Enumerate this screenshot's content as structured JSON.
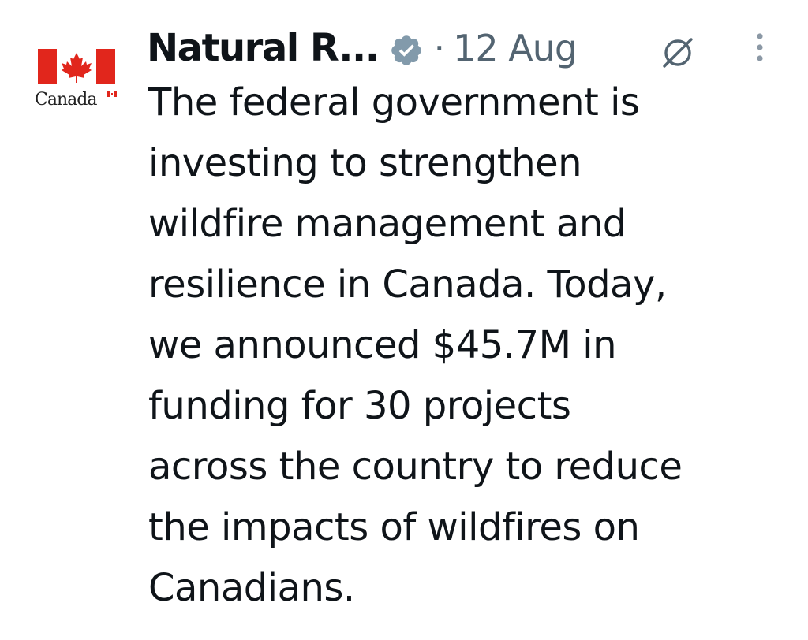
{
  "account": {
    "name": "Natural R...",
    "logo_wordmark": "Canada",
    "verified": true,
    "verified_badge_color": "#829aab"
  },
  "header": {
    "separator": "·",
    "date": "12 Aug"
  },
  "icons": {
    "grok": "grok-slash-icon",
    "more": "more-vertical-icon"
  },
  "post": {
    "lines": [
      "The federal government is",
      "investing to strengthen",
      "wildfire management and",
      "resilience in Canada. Today,",
      "we announced $45.7M in",
      "funding for 30 projects",
      "across the country to reduce",
      "the impacts of wildfires on",
      "Canadians."
    ]
  },
  "colors": {
    "flag_red": "#e1261c",
    "text_primary": "#0f1419",
    "text_secondary": "#536471"
  }
}
